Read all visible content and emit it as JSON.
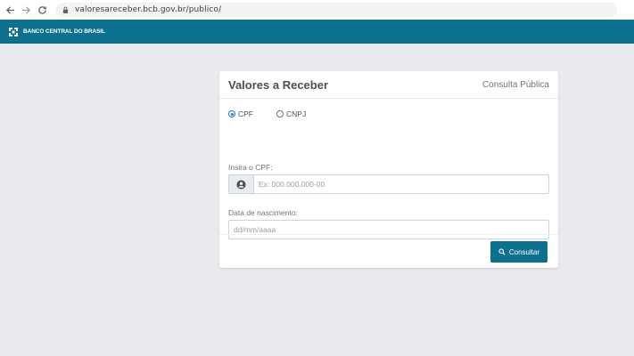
{
  "browser": {
    "url": "valoresareceber.bcb.gov.br/publico/"
  },
  "header": {
    "brand_name": "BANCO CENTRAL DO BRASIL"
  },
  "card": {
    "title": "Valores a Receber",
    "subtitle": "Consulta Pública",
    "document_type": {
      "options": [
        {
          "label": "CPF",
          "selected": true
        },
        {
          "label": "CNPJ",
          "selected": false
        }
      ]
    },
    "cpf_field": {
      "label": "Insira o CPF:",
      "placeholder": "Ex: 000.000.000-00",
      "value": ""
    },
    "birthdate_field": {
      "label": "Data de nascimento:",
      "placeholder": "dd/mm/aaaa",
      "value": ""
    },
    "submit_label": "Consultar"
  },
  "icons": {
    "back": "arrow-left-icon",
    "forward": "arrow-right-icon",
    "reload": "reload-icon",
    "lock": "lock-icon",
    "logo": "bcb-logo-icon",
    "user": "user-circle-icon",
    "search": "search-icon"
  },
  "colors": {
    "brand": "#0c708f",
    "page_background": "#e8eaed",
    "radio_selected": "#1a73e8"
  }
}
